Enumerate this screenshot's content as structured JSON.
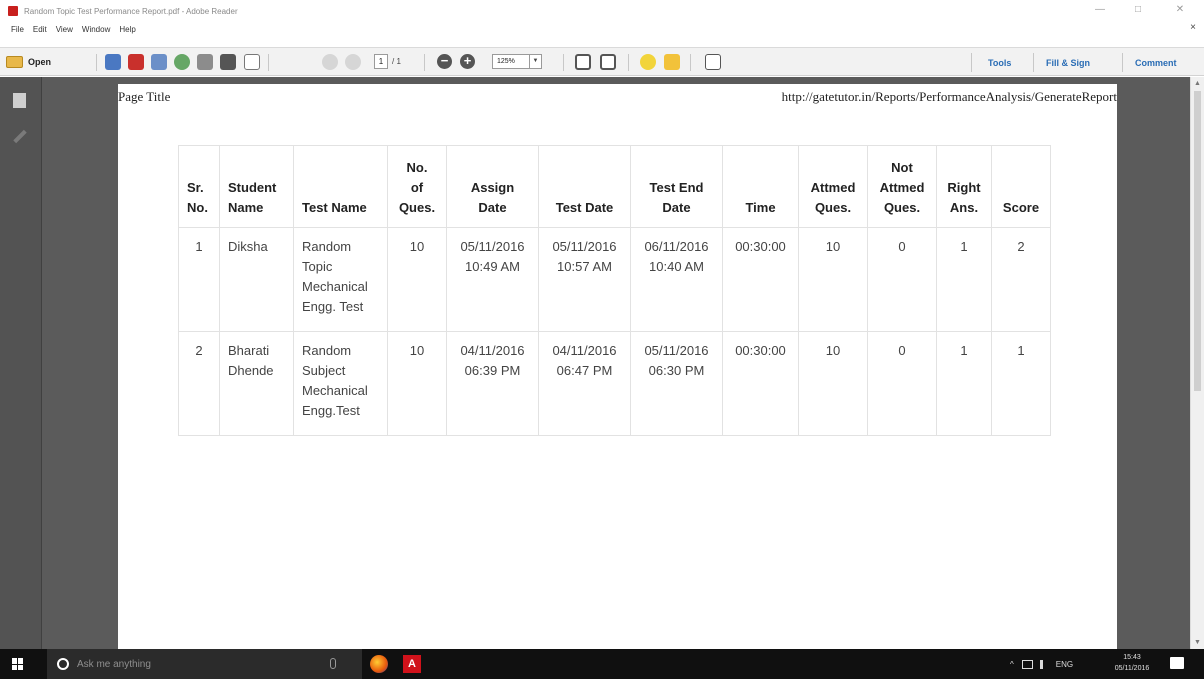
{
  "window": {
    "title": "Random Topic Test Performance Report.pdf - Adobe Reader",
    "minimize": "—",
    "maximize": "□",
    "close": "✕"
  },
  "menubar": {
    "items": [
      "File",
      "Edit",
      "View",
      "Window",
      "Help"
    ],
    "close_doc": "×"
  },
  "toolbar": {
    "open_label": "Open",
    "current_page": "1",
    "total_pages": "/ 1",
    "zoom": "125%",
    "zoom_out": "−",
    "zoom_in": "+",
    "tools_label": "Tools",
    "fill_sign_label": "Fill & Sign",
    "comment_label": "Comment"
  },
  "document": {
    "page_title": "Page Title",
    "url": "http://gatetutor.in/Reports/PerformanceAnalysis/GenerateReport",
    "table": {
      "headers": [
        [
          "Sr.",
          "No."
        ],
        [
          "Student",
          "Name"
        ],
        [
          "Test Name"
        ],
        [
          "No.",
          "of",
          "Ques."
        ],
        [
          "Assign",
          "Date"
        ],
        [
          "Test Date"
        ],
        [
          "Test End",
          "Date"
        ],
        [
          "Time"
        ],
        [
          "Attmed",
          "Ques."
        ],
        [
          "Not",
          "Attmed",
          "Ques."
        ],
        [
          "Right",
          "Ans."
        ],
        [
          "Score"
        ]
      ],
      "rows": [
        {
          "sr": "1",
          "student": [
            "Diksha"
          ],
          "test_name": [
            "Random",
            "Topic",
            "Mechanical",
            "Engg. Test"
          ],
          "questions": "10",
          "assign_date": [
            "05/11/2016",
            "10:49 AM"
          ],
          "test_date": [
            "05/11/2016",
            "10:57 AM"
          ],
          "end_date": [
            "06/11/2016",
            "10:40 AM"
          ],
          "time": "00:30:00",
          "attempted": "10",
          "not_attempted": "0",
          "right": "1",
          "score": "2"
        },
        {
          "sr": "2",
          "student": [
            "Bharati",
            "Dhende"
          ],
          "test_name": [
            "Random",
            "Subject",
            "Mechanical",
            "Engg.Test"
          ],
          "questions": "10",
          "assign_date": [
            "04/11/2016",
            "06:39 PM"
          ],
          "test_date": [
            "04/11/2016",
            "06:47 PM"
          ],
          "end_date": [
            "05/11/2016",
            "06:30 PM"
          ],
          "time": "00:30:00",
          "attempted": "10",
          "not_attempted": "0",
          "right": "1",
          "score": "1"
        }
      ]
    }
  },
  "taskbar": {
    "search_placeholder": "Ask me anything",
    "lang": "ENG",
    "time": "15:43",
    "date": "05/11/2016",
    "tray_arrow": "^"
  }
}
